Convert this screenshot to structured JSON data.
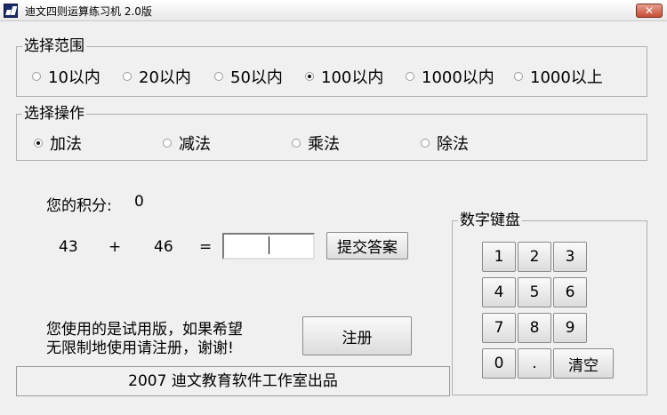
{
  "window": {
    "title": "迪文四则运算练习机  2.0版",
    "close_glyph": "✕"
  },
  "range": {
    "legend": "选择范围",
    "options": [
      "10以内",
      "20以内",
      "50以内",
      "100以内",
      "1000以内",
      "1000以上"
    ],
    "selected": "100以内"
  },
  "operation": {
    "legend": "选择操作",
    "options": [
      "加法",
      "减法",
      "乘法",
      "除法"
    ],
    "selected": "加法"
  },
  "score": {
    "label": "您的积分:",
    "value": "0"
  },
  "problem": {
    "operand1": "43",
    "operator": "+",
    "operand2": "46",
    "equals": "=",
    "answer": ""
  },
  "submit_label": "提交答案",
  "trial": {
    "line1": "您使用的是试用版，如果希望",
    "line2": "无限制地使用请注册，谢谢!"
  },
  "register_label": "注册",
  "keypad": {
    "legend": "数字键盘",
    "keys": [
      "1",
      "2",
      "3",
      "4",
      "5",
      "6",
      "7",
      "8",
      "9",
      "0",
      ".",
      "清空"
    ]
  },
  "footer": "2007 迪文教育软件工作室出品"
}
